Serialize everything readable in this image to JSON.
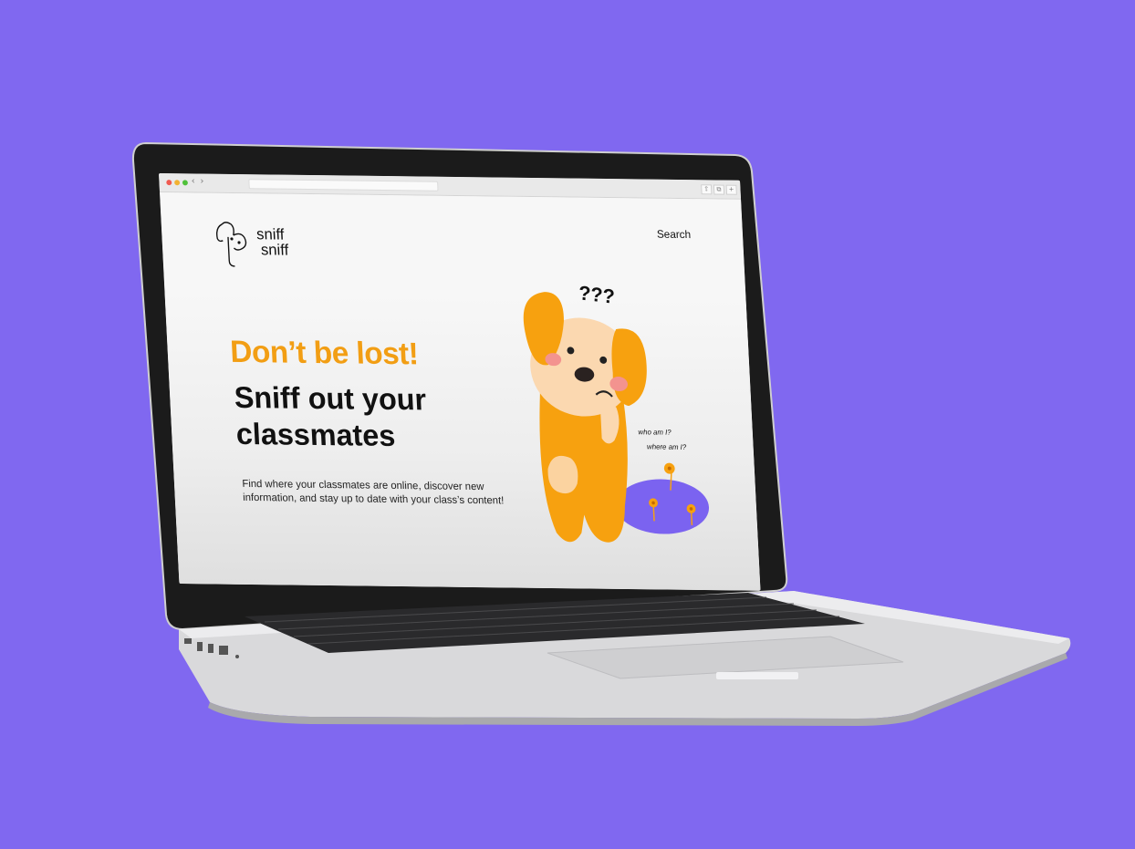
{
  "browser": {
    "controls": [
      "close",
      "minimize",
      "maximize"
    ],
    "nav": {
      "back": "‹",
      "forward": "›"
    }
  },
  "site": {
    "logo": {
      "line1": "sniff",
      "line2": "sniff"
    },
    "nav": {
      "search_label": "Search"
    },
    "hero": {
      "headline_accent": "Don’t be lost!",
      "headline_line1": "Sniff out your",
      "headline_line2": "classmates",
      "description_line1": "Find where your classmates are online, discover new",
      "description_line2": "information, and stay up to date with your class’s content!"
    },
    "illustration": {
      "question_marks": "???",
      "thought_1": "who am I?",
      "thought_2": "where am I?"
    }
  },
  "colors": {
    "background": "#8068f0",
    "accent_orange": "#f29e14",
    "dog_orange": "#f7a10f",
    "dog_face": "#fbd8b0",
    "puddle_purple": "#7b63f0",
    "text_dark": "#111111"
  }
}
